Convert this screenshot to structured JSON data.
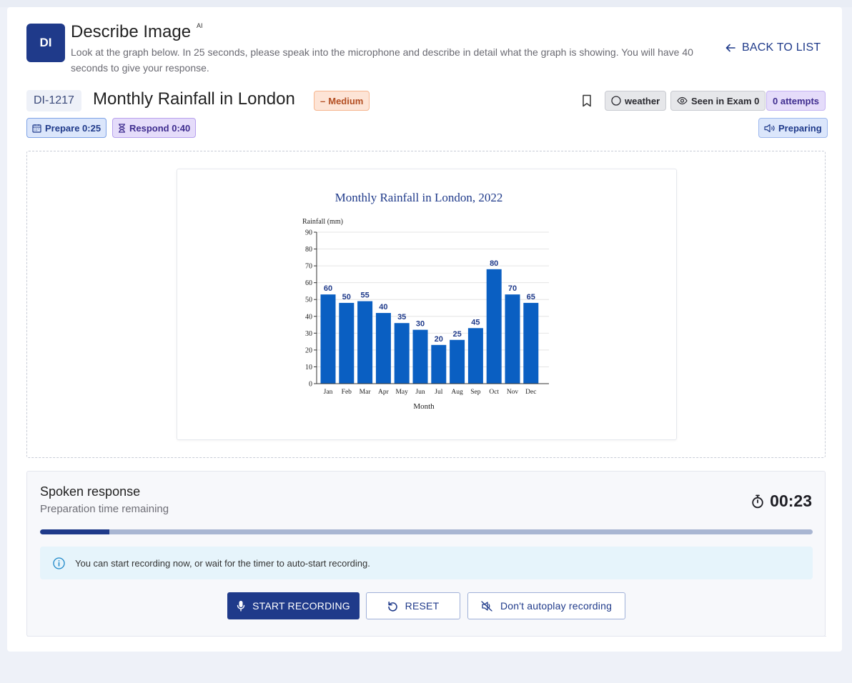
{
  "header": {
    "badge": "DI",
    "title": "Describe Image",
    "ai_tag": "AI",
    "instructions": "Look at the graph below. In 25 seconds, please speak into the microphone and describe in detail what the graph is showing. You will have 40 seconds to give your response.",
    "back_label": "BACK TO LIST"
  },
  "question": {
    "id": "DI-1217",
    "title": "Monthly Rainfall in London",
    "difficulty": "Medium",
    "tags": {
      "topic": "weather",
      "seen": "Seen in Exam 0",
      "attempts": "0 attempts"
    },
    "prepare": "Prepare 0:25",
    "respond": "Respond 0:40",
    "status": "Preparing"
  },
  "chart_data": {
    "type": "bar",
    "title": "Monthly Rainfall in London, 2022",
    "ylabel": "Rainfall (mm)",
    "xlabel": "Month",
    "categories": [
      "Jan",
      "Feb",
      "Mar",
      "Apr",
      "May",
      "Jun",
      "Jul",
      "Aug",
      "Sep",
      "Oct",
      "Nov",
      "Dec"
    ],
    "values": [
      53,
      48,
      49,
      42,
      36,
      32,
      23,
      26,
      33,
      68,
      53,
      48
    ],
    "data_labels": [
      "60",
      "50",
      "55",
      "40",
      "35",
      "30",
      "20",
      "25",
      "45",
      "80",
      "70",
      "65"
    ],
    "ylim": [
      0,
      90
    ],
    "yticks": [
      0,
      10,
      20,
      30,
      40,
      50,
      60,
      70,
      80,
      90
    ],
    "grid": true,
    "bar_color": "#0a5fc2"
  },
  "response": {
    "title": "Spoken response",
    "subtitle": "Preparation time remaining",
    "countdown": "00:23",
    "progress_fraction": 0.09,
    "info": "You can start recording now, or wait for the timer to auto-start recording.",
    "start_label": "START RECORDING",
    "reset_label": "RESET",
    "autoplay_label": "Don't autoplay recording"
  },
  "colors": {
    "accent": "#1f3a8a",
    "medium": "#b34e22",
    "bar": "#0a5fc2"
  }
}
